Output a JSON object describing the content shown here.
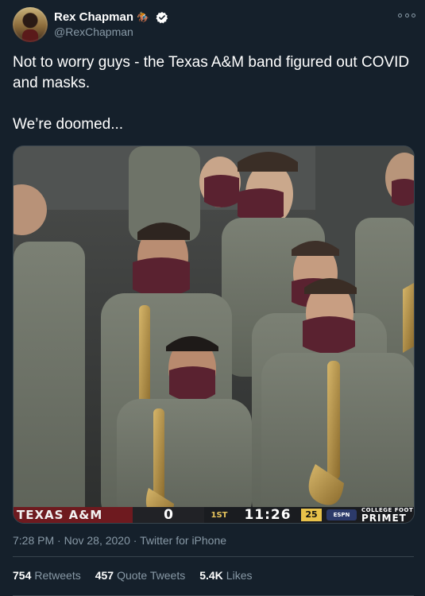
{
  "tweet": {
    "display_name": "Rex Chapman",
    "handle": "@RexChapman",
    "verified": true,
    "text_line_1": "Not to worry guys - the Texas A&M band figured out COVID and masks.",
    "text_line_2": "We’re doomed...",
    "time": "7:28 PM",
    "date": "Nov 28, 2020",
    "source": "Twitter for iPhone",
    "meta_separator": "·"
  },
  "media": {
    "scorebug": {
      "team": "TEXAS A&M",
      "score": "0",
      "quarter": "1ST",
      "clock": "11:26",
      "play_clock": "25",
      "network": "ESPN",
      "brand_top": "COLLEGE FOOT",
      "brand_bottom": "PRIMET"
    }
  },
  "stats": [
    {
      "count": "754",
      "label": "Retweets"
    },
    {
      "count": "457",
      "label": "Quote Tweets"
    },
    {
      "count": "5.4K",
      "label": "Likes"
    }
  ],
  "colors": {
    "background": "#15202b",
    "text_primary": "#ffffff",
    "text_secondary": "#8899a6",
    "border": "#38444d",
    "verified": "#1da1f2",
    "mask_maroon": "#5a2230",
    "uniform_olive": "#6f7468"
  },
  "icons": [
    "horse-icon",
    "verified-icon",
    "more-icon"
  ]
}
